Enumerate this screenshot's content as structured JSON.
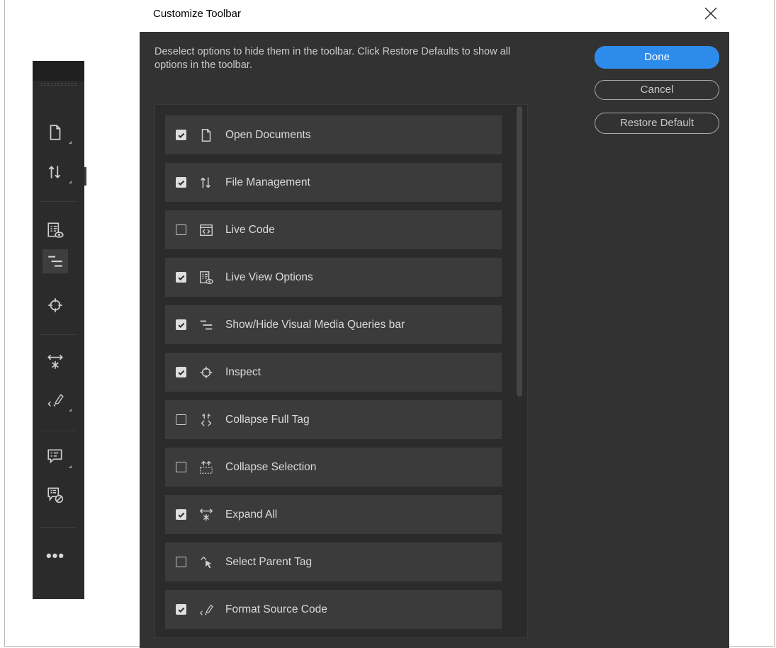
{
  "dialog": {
    "title": "Customize Toolbar",
    "instructions": "Deselect options to hide them in the toolbar. Click Restore Defaults to show all options in the toolbar.",
    "buttons": {
      "done": "Done",
      "cancel": "Cancel",
      "restore": "Restore Default"
    },
    "accent_color": "#2d8ceb",
    "items": [
      {
        "label": "Open Documents",
        "checked": true,
        "icon": "document-icon"
      },
      {
        "label": "File Management",
        "checked": true,
        "icon": "file-transfer-icon"
      },
      {
        "label": "Live Code",
        "checked": false,
        "icon": "live-code-icon"
      },
      {
        "label": "Live View Options",
        "checked": true,
        "icon": "live-view-options-icon"
      },
      {
        "label": "Show/Hide Visual Media Queries bar",
        "checked": true,
        "icon": "media-queries-icon"
      },
      {
        "label": "Inspect",
        "checked": true,
        "icon": "inspect-crosshair-icon"
      },
      {
        "label": "Collapse Full Tag",
        "checked": false,
        "icon": "collapse-full-tag-icon"
      },
      {
        "label": "Collapse Selection",
        "checked": false,
        "icon": "collapse-selection-icon"
      },
      {
        "label": "Expand All",
        "checked": true,
        "icon": "expand-all-icon"
      },
      {
        "label": "Select Parent Tag",
        "checked": false,
        "icon": "select-parent-tag-icon"
      },
      {
        "label": "Format Source Code",
        "checked": true,
        "icon": "format-source-code-icon"
      }
    ]
  },
  "side_toolbar": {
    "icons": [
      "document-icon",
      "file-transfer-icon",
      "live-view-options-icon",
      "media-queries-icon",
      "inspect-crosshair-icon",
      "expand-all-icon",
      "format-source-code-icon",
      "comment-icon",
      "comment-hide-icon",
      "more-icon"
    ],
    "more_label": "•••"
  }
}
